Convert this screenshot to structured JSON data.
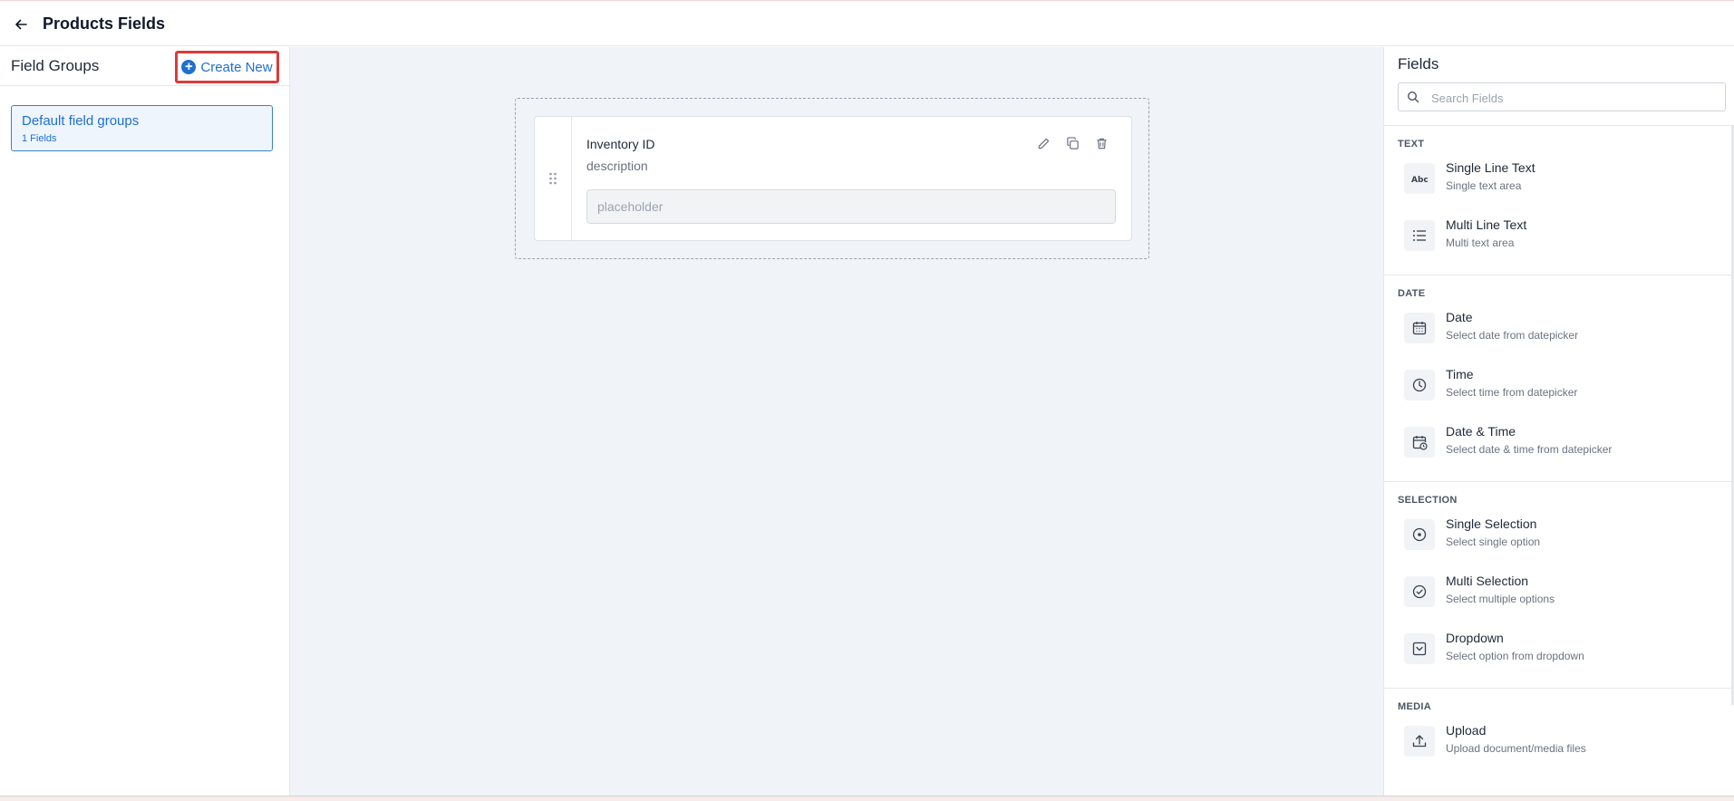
{
  "header": {
    "title": "Products Fields"
  },
  "field_groups": {
    "title": "Field Groups",
    "create_new_label": "Create New",
    "groups": [
      {
        "name": "Default field groups",
        "count": "1 Fields"
      }
    ]
  },
  "canvas": {
    "field": {
      "label": "Inventory ID",
      "description": "description",
      "placeholder": "placeholder"
    }
  },
  "fields_panel": {
    "title": "Fields",
    "search_placeholder": "Search Fields",
    "sections": [
      {
        "title": "TEXT",
        "items": [
          {
            "name": "Single Line Text",
            "desc": "Single text area",
            "icon": "abc-icon"
          },
          {
            "name": "Multi Line Text",
            "desc": "Multi text area",
            "icon": "list-icon"
          }
        ]
      },
      {
        "title": "DATE",
        "items": [
          {
            "name": "Date",
            "desc": "Select date from datepicker",
            "icon": "calendar-icon"
          },
          {
            "name": "Time",
            "desc": "Select time from datepicker",
            "icon": "clock-icon"
          },
          {
            "name": "Date & Time",
            "desc": "Select date & time from datepicker",
            "icon": "calendar-clock-icon"
          }
        ]
      },
      {
        "title": "SELECTION",
        "items": [
          {
            "name": "Single Selection",
            "desc": "Select single option",
            "icon": "radio-icon"
          },
          {
            "name": "Multi Selection",
            "desc": "Select multiple options",
            "icon": "check-circle-icon"
          },
          {
            "name": "Dropdown",
            "desc": "Select option from dropdown",
            "icon": "dropdown-icon"
          }
        ]
      },
      {
        "title": "MEDIA",
        "items": [
          {
            "name": "Upload",
            "desc": "Upload document/media files",
            "icon": "upload-icon"
          }
        ]
      }
    ]
  },
  "colors": {
    "accent": "#1f6fd1",
    "highlight_border": "#dc3b3b",
    "canvas_bg": "#f0f3f8"
  }
}
